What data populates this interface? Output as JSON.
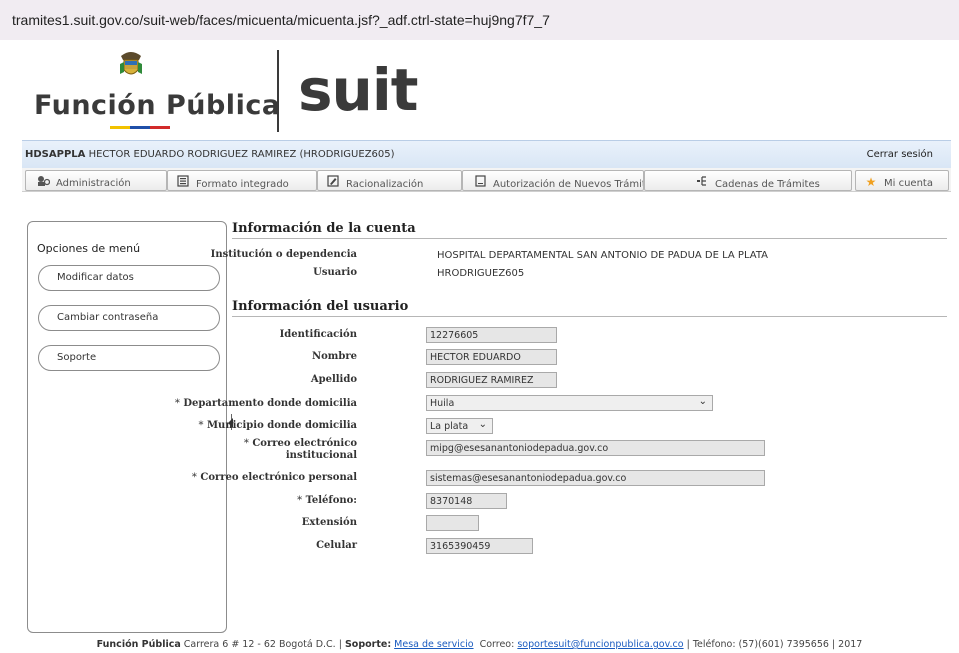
{
  "browser": {
    "url": "tramites1.suit.gov.co/suit-web/faces/micuenta/micuenta.jsf?_adf.ctrl-state=huj9ng7f7_7"
  },
  "header": {
    "brand_left": "Función Pública",
    "brand_right": "suit",
    "colors": {
      "yellow": "#f2c200",
      "blue": "#1f4fa8",
      "red": "#d22a2a"
    }
  },
  "user_bar": {
    "code": "HDSAPPLA",
    "user": "HECTOR EDUARDO RODRIGUEZ RAMIREZ (HRODRIGUEZ605)",
    "logout": "Cerrar sesión"
  },
  "menu": [
    {
      "label": "Administración",
      "icon": "admin-icon"
    },
    {
      "label": "Formato integrado",
      "icon": "form-icon"
    },
    {
      "label": "Racionalización",
      "icon": "edit-icon"
    },
    {
      "label": "Autorización de Nuevos Trámites",
      "icon": "document-icon"
    },
    {
      "label": "Cadenas de Trámites",
      "icon": "chain-icon"
    },
    {
      "label": "Mi cuenta",
      "icon": "star-icon"
    }
  ],
  "sidebar": {
    "title": "Opciones de menú",
    "items": [
      "Modificar datos",
      "Cambiar contraseña",
      "Soporte"
    ]
  },
  "account_info": {
    "title": "Información de la cuenta",
    "institution_label": "Institución o dependencia",
    "institution_value": "HOSPITAL DEPARTAMENTAL SAN ANTONIO DE PADUA DE LA PLATA",
    "user_label": "Usuario",
    "user_value": "HRODRIGUEZ605"
  },
  "user_info": {
    "title": "Información del usuario",
    "required_mark": "*",
    "id_label": "Identificación",
    "id_value": "12276605",
    "name_label": "Nombre",
    "name_value": "HECTOR EDUARDO",
    "surname_label": "Apellido",
    "surname_value": "RODRIGUEZ RAMIREZ",
    "dept_label": "Departamento donde domicilia",
    "dept_value": "Huila",
    "muni_label": "Municipio donde domicilia",
    "muni_value": "La plata",
    "inst_email_label_1": "Correo electrónico",
    "inst_email_label_2": "institucional",
    "inst_email_value": "mipg@esesanantoniodepadua.gov.co",
    "personal_email_label": "Correo electrónico personal",
    "personal_email_value": "sistemas@esesanantoniodepadua.gov.co",
    "phone_label": "Teléfono:",
    "phone_value": "8370148",
    "ext_label": "Extensión",
    "ext_value": "",
    "mobile_label": "Celular",
    "mobile_value": "3165390459"
  },
  "footer": {
    "org": "Función Pública",
    "address": "Carrera 6 # 12 - 62 Bogotá D.C. |",
    "support_label": "Soporte:",
    "support_link": "Mesa de servicio",
    "email_label": "Correo:",
    "email_link": "soportesuit@funcionpublica.gov.co",
    "phone": "| Teléfono: (57)(601) 7395656 | 2017"
  }
}
